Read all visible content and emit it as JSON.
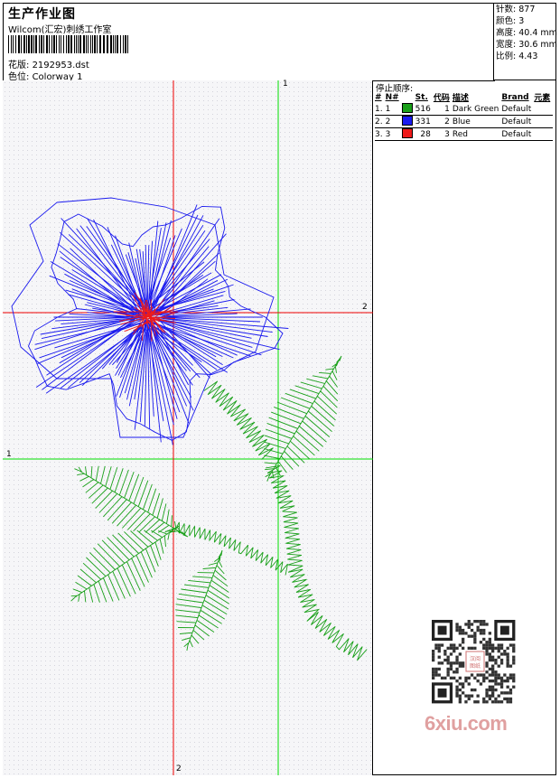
{
  "header": {
    "title": "生产作业图",
    "company": "Wilcom(汇宏)刺绣工作室",
    "design_label": "花版:",
    "design_file": "2192953.dst",
    "colorway_label": "色位:",
    "colorway": "Colorway 1"
  },
  "stats": [
    {
      "label": "针数:",
      "value": "877"
    },
    {
      "label": "颜色:",
      "value": "3"
    },
    {
      "label": "高度:",
      "value": "40.4 mm"
    },
    {
      "label": "宽度:",
      "value": "30.6 mm"
    },
    {
      "label": "比例:",
      "value": "4.43"
    }
  ],
  "stop_sequence": {
    "title": "停止顺序:",
    "headers": [
      "#",
      "N#",
      "St.",
      "代码",
      "描述",
      "Brand",
      "元素"
    ],
    "rows": [
      {
        "idx": "1.",
        "n": "1",
        "color": "#1aa01a",
        "st": "516",
        "code": "1",
        "desc": "Dark Green",
        "brand": "Default"
      },
      {
        "idx": "2.",
        "n": "2",
        "color": "#1a1aee",
        "st": "331",
        "code": "2",
        "desc": "Blue",
        "brand": "Default"
      },
      {
        "idx": "3.",
        "n": "3",
        "color": "#ee1a1a",
        "st": "28",
        "code": "3",
        "desc": "Red",
        "brand": "Default"
      }
    ]
  },
  "guides": {
    "green_top": "1",
    "green_left": "1",
    "red_right": "2",
    "red_bottom": "2"
  },
  "colors": {
    "green_thread": "#1aa01a",
    "blue_thread": "#1a1aee",
    "red_thread": "#ee1a1a",
    "guide_green": "#00dd00",
    "guide_red": "#ee0000"
  },
  "watermark": {
    "qr_center_text": "汉阅图纸",
    "site": "6xiu.com"
  }
}
